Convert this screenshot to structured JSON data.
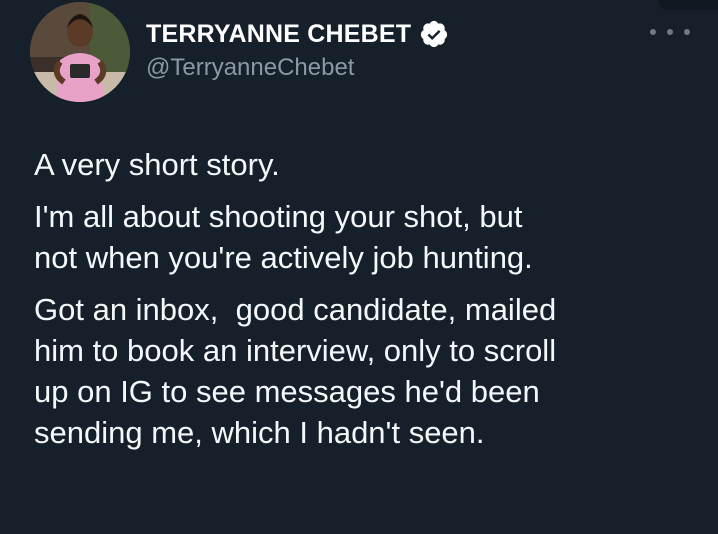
{
  "tweet": {
    "author": {
      "display_name": "TERRYANNE CHEBET",
      "handle": "@TerryanneChebet",
      "verified_icon": "verified-badge-icon",
      "avatar": "profile-photo"
    },
    "more_icon": "more-options-icon",
    "paragraphs": [
      {
        "lines": [
          "A very short story."
        ]
      },
      {
        "lines": [
          "I'm all about shooting your shot, but",
          "not when you're actively job hunting."
        ]
      },
      {
        "lines": [
          "Got an inbox,  good candidate, mailed",
          "him to book an interview, only to scroll",
          "up on IG to see messages he'd been",
          "sending me, which I hadn't seen."
        ]
      }
    ]
  },
  "colors": {
    "background": "#15202b",
    "text": "#f5f8fa",
    "secondary_text": "#8b98a5",
    "verified_badge": "#ffffff"
  }
}
